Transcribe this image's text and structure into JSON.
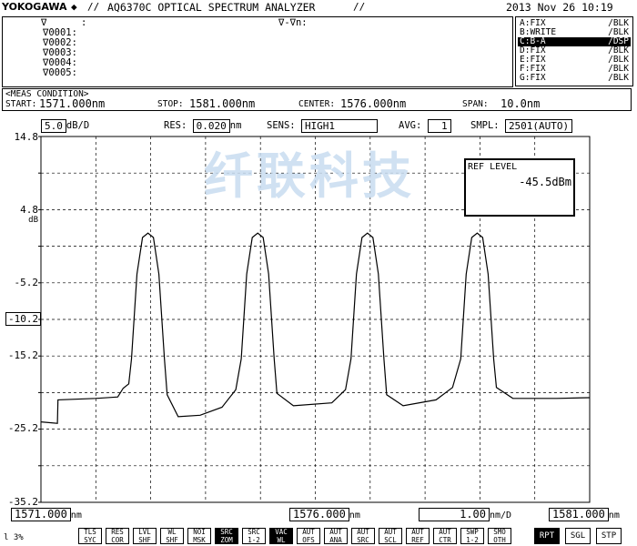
{
  "header": {
    "brand": "YOKOGAWA",
    "brand_mark": "◆",
    "separator": "//",
    "model_title": "AQ6370C OPTICAL SPECTRUM ANALYZER",
    "title_end": "//",
    "datetime": "2013 Nov 26 10:19"
  },
  "markers": {
    "ref_label": "∇",
    "ref_colon": ":",
    "delta_header": "∇-∇n:",
    "rows": [
      "∇0001:",
      "∇0002:",
      "∇0003:",
      "∇0004:",
      "∇0005:"
    ]
  },
  "traces": [
    {
      "name": "A:FIX",
      "status": "/BLK",
      "active": false
    },
    {
      "name": "B:WRITE",
      "status": "/BLK",
      "active": false
    },
    {
      "name": "C:B-A",
      "status": "/DSP",
      "active": true
    },
    {
      "name": "D:FIX",
      "status": "/BLK",
      "active": false
    },
    {
      "name": "E:FIX",
      "status": "/BLK",
      "active": false
    },
    {
      "name": "F:FIX",
      "status": "/BLK",
      "active": false
    },
    {
      "name": "G:FIX",
      "status": "/BLK",
      "active": false
    }
  ],
  "meas": {
    "title": "<MEAS CONDITION>",
    "start_label": "START:",
    "start_value": "1571.000nm",
    "stop_label": "STOP:",
    "stop_value": "1581.000nm",
    "center_label": "CENTER:",
    "center_value": "1576.000nm",
    "span_label": "SPAN:",
    "span_value": "10.0nm"
  },
  "params": {
    "scale_value": "5.0",
    "scale_unit": "dB/D",
    "res_label": "RES:",
    "res_value": "0.020",
    "res_unit": "nm",
    "sens_label": "SENS:",
    "sens_value": "HIGH1",
    "avg_label": "AVG:",
    "avg_value": "1",
    "smpl_label": "SMPL:",
    "smpl_value": "2501(AUTO)"
  },
  "ref_level": {
    "label": "REF LEVEL",
    "value": "-45.5dBm"
  },
  "watermark": "纤联科技",
  "chart_data": {
    "type": "line",
    "xlabel": "",
    "ylabel": "dB",
    "x_unit": "nm",
    "xlim": [
      1571.0,
      1581.0
    ],
    "ylim": [
      -35.2,
      14.8
    ],
    "grid": true,
    "y_ticks": [
      "14.8",
      "4.8",
      "-5.2",
      "-15.2",
      "-25.2",
      "-35.2"
    ],
    "ref_marker": "-10.2",
    "series": [
      {
        "points": [
          [
            1571.0,
            -24.2
          ],
          [
            1571.3,
            -24.4
          ],
          [
            1571.31,
            -21.2
          ],
          [
            1572.0,
            -21.0
          ],
          [
            1572.4,
            -20.8
          ],
          [
            1572.5,
            -19.6
          ],
          [
            1572.6,
            -19.0
          ],
          [
            1572.65,
            -15.6
          ],
          [
            1572.75,
            -4.0
          ],
          [
            1572.85,
            1.0
          ],
          [
            1572.95,
            1.6
          ],
          [
            1573.05,
            1.0
          ],
          [
            1573.15,
            -4.0
          ],
          [
            1573.25,
            -15.6
          ],
          [
            1573.3,
            -20.5
          ],
          [
            1573.5,
            -23.5
          ],
          [
            1573.9,
            -23.3
          ],
          [
            1574.3,
            -22.2
          ],
          [
            1574.55,
            -19.8
          ],
          [
            1574.65,
            -15.6
          ],
          [
            1574.75,
            -4.0
          ],
          [
            1574.85,
            1.0
          ],
          [
            1574.95,
            1.6
          ],
          [
            1575.05,
            1.0
          ],
          [
            1575.15,
            -4.0
          ],
          [
            1575.25,
            -15.6
          ],
          [
            1575.3,
            -20.3
          ],
          [
            1575.6,
            -22.0
          ],
          [
            1576.3,
            -21.6
          ],
          [
            1576.55,
            -19.8
          ],
          [
            1576.65,
            -15.6
          ],
          [
            1576.75,
            -4.0
          ],
          [
            1576.85,
            1.0
          ],
          [
            1576.95,
            1.6
          ],
          [
            1577.05,
            1.0
          ],
          [
            1577.15,
            -4.0
          ],
          [
            1577.25,
            -15.6
          ],
          [
            1577.3,
            -20.5
          ],
          [
            1577.6,
            -22.0
          ],
          [
            1578.2,
            -21.2
          ],
          [
            1578.5,
            -19.5
          ],
          [
            1578.65,
            -15.6
          ],
          [
            1578.75,
            -4.0
          ],
          [
            1578.85,
            1.0
          ],
          [
            1578.95,
            1.6
          ],
          [
            1579.05,
            1.0
          ],
          [
            1579.15,
            -4.0
          ],
          [
            1579.25,
            -15.6
          ],
          [
            1579.3,
            -19.5
          ],
          [
            1579.6,
            -21.0
          ],
          [
            1580.4,
            -21.0
          ],
          [
            1581.0,
            -20.9
          ]
        ]
      }
    ],
    "x_readouts": {
      "start": "1571.000",
      "start_unit": "nm",
      "center": "1576.000",
      "center_unit": "nm",
      "per_div": "1.00",
      "per_div_unit": "nm/D",
      "stop": "1581.000",
      "stop_unit": "nm"
    }
  },
  "status": {
    "left": "l 3%"
  },
  "softkeys": [
    {
      "top": "TLS",
      "bottom": "SYC",
      "inverted": false
    },
    {
      "top": "RES",
      "bottom": "COR",
      "inverted": false
    },
    {
      "top": "LVL",
      "bottom": "SHF",
      "inverted": false
    },
    {
      "top": "WL",
      "bottom": "SHF",
      "inverted": false
    },
    {
      "top": "NOI",
      "bottom": "MSK",
      "inverted": false
    },
    {
      "top": "SRC",
      "bottom": "ZOM",
      "inverted": true
    },
    {
      "top": "SRC",
      "bottom": "1-2",
      "inverted": false
    },
    {
      "top": "VAC",
      "bottom": "WL",
      "inverted": true
    },
    {
      "top": "AUT",
      "bottom": "OFS",
      "inverted": false
    },
    {
      "top": "AUT",
      "bottom": "ANA",
      "inverted": false
    },
    {
      "top": "AUT",
      "bottom": "SRC",
      "inverted": false
    },
    {
      "top": "AUT",
      "bottom": "SCL",
      "inverted": false
    },
    {
      "top": "AUT",
      "bottom": "REF",
      "inverted": false
    },
    {
      "top": "AUT",
      "bottom": "CTR",
      "inverted": false
    },
    {
      "top": "SWP",
      "bottom": "1-2",
      "inverted": false
    },
    {
      "top": "SMO",
      "bottom": "OTH",
      "inverted": false
    }
  ],
  "run_buttons": [
    {
      "label": "RPT",
      "inverted": true
    },
    {
      "label": "SGL",
      "inverted": false
    },
    {
      "label": "STP",
      "inverted": false
    }
  ]
}
